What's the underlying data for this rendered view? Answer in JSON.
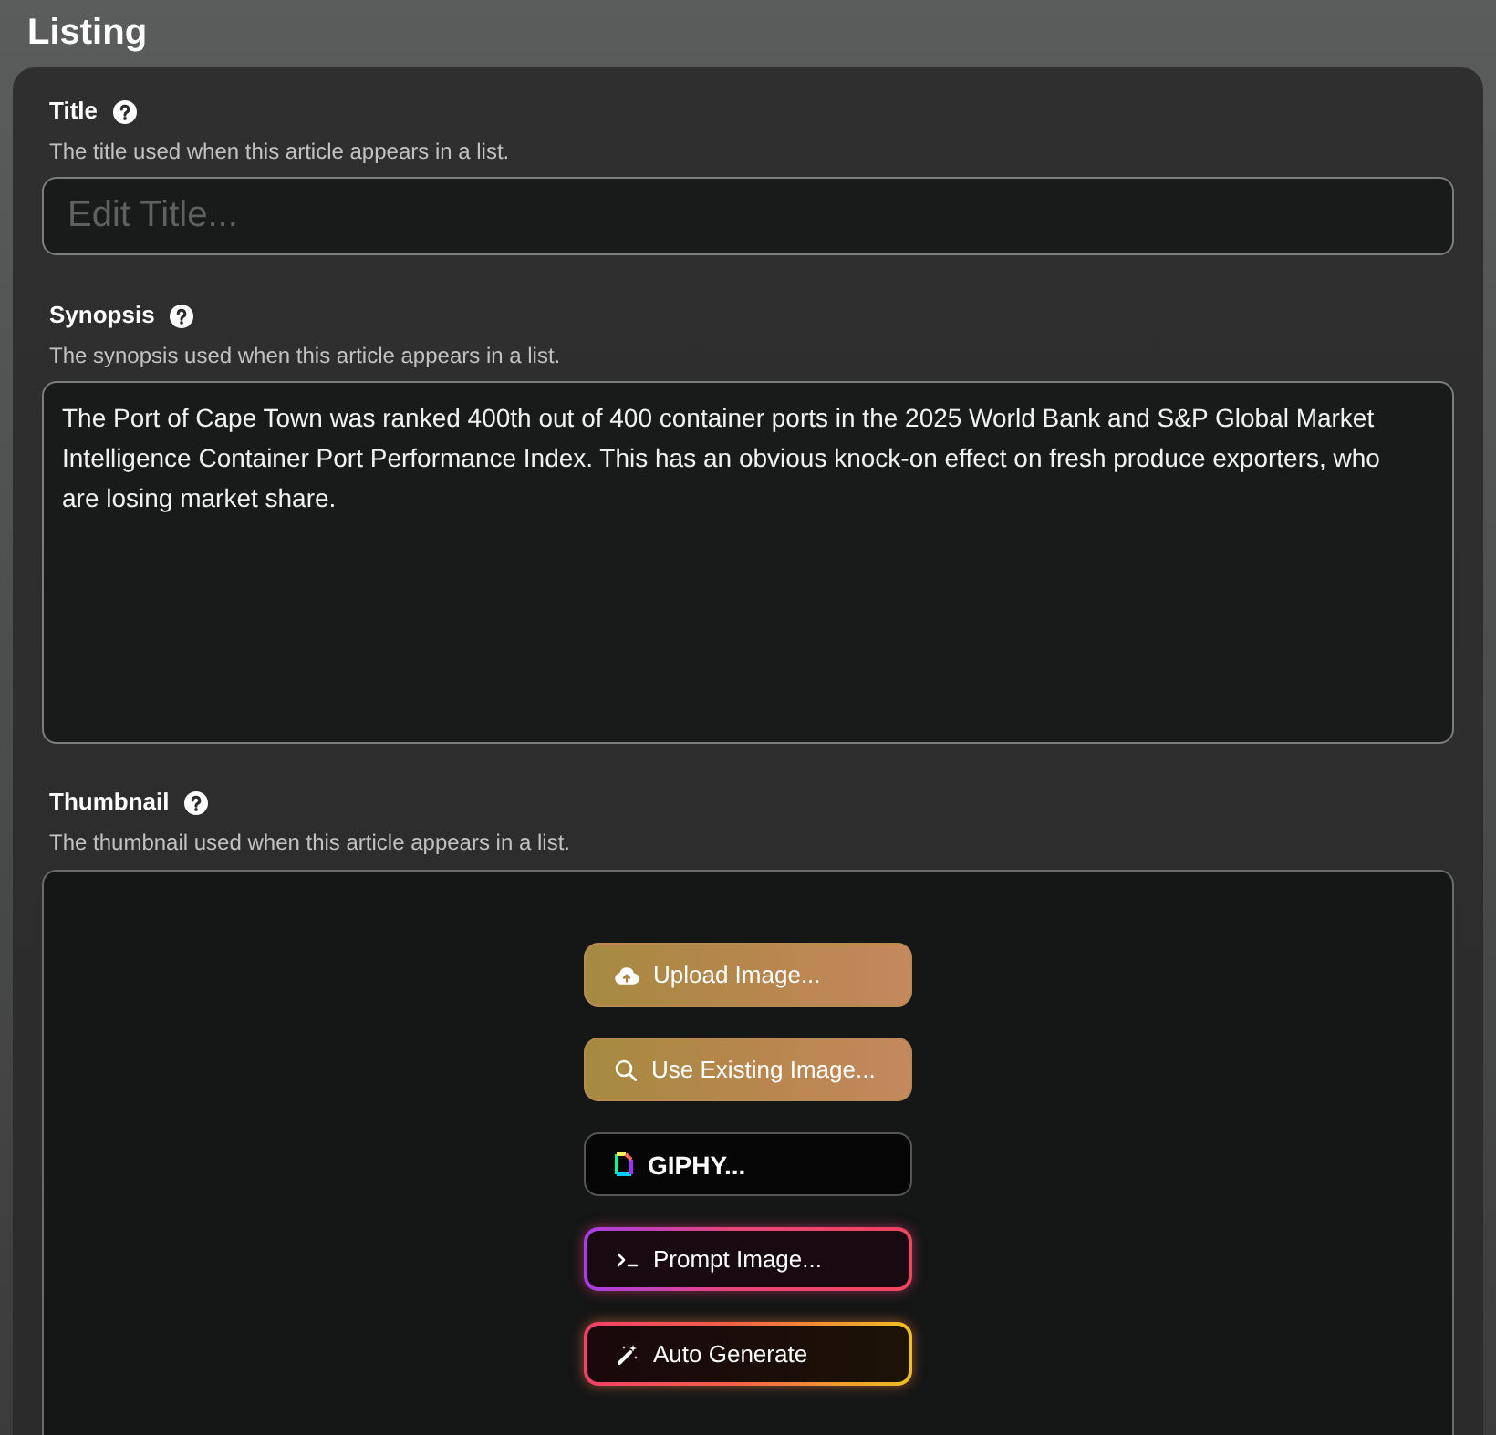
{
  "heading": "Listing",
  "fields": [
    {
      "kind": "text-input",
      "label": "Title",
      "description": "The title used when this article appears in a list.",
      "placeholder": "Edit Title..."
    },
    {
      "kind": "textarea",
      "label": "Synopsis",
      "description": "The synopsis used when this article appears in a list.",
      "value": "The Port of Cape Town was ranked 400th out of 400 container ports in the 2025 World Bank and S&P Global Market Intelligence Container Port Performance Index. This has an obvious knock-on effect on fresh produce exporters, who are losing market share."
    },
    {
      "kind": "image-picker",
      "label": "Thumbnail",
      "description": "The thumbnail used when this article appears in a list.",
      "buttons": [
        {
          "kind": "upload",
          "label": "Upload Image..."
        },
        {
          "kind": "existing",
          "label": "Use Existing Image..."
        },
        {
          "kind": "giphy",
          "label": "GIPHY..."
        },
        {
          "kind": "prompt",
          "label": "Prompt Image..."
        },
        {
          "kind": "generate",
          "label": "Auto Generate"
        }
      ]
    }
  ]
}
